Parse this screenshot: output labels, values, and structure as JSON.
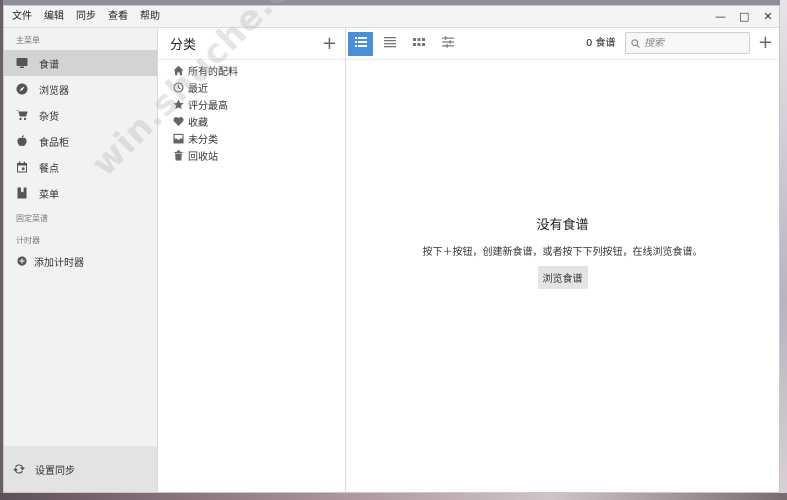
{
  "menubar": {
    "items": [
      "文件",
      "编辑",
      "同步",
      "查看",
      "帮助"
    ],
    "controls": {
      "minimize": "—",
      "maximize": "□",
      "close": "✕"
    }
  },
  "sidebar": {
    "main_label": "主菜单",
    "items": [
      {
        "label": "食谱",
        "icon": "monitor-icon",
        "active": true
      },
      {
        "label": "浏览器",
        "icon": "compass-icon",
        "active": false
      },
      {
        "label": "杂货",
        "icon": "cart-icon",
        "active": false
      },
      {
        "label": "食品柜",
        "icon": "apple-icon",
        "active": false
      },
      {
        "label": "餐点",
        "icon": "calendar-icon",
        "active": false
      },
      {
        "label": "菜单",
        "icon": "book-icon",
        "active": false
      }
    ],
    "pinned_label": "固定菜谱",
    "timer_label": "计时器",
    "add_timer": "添加计时器",
    "footer": "设置同步"
  },
  "categories": {
    "title": "分类",
    "add": "+",
    "items": [
      {
        "label": "所有的配料",
        "icon": "home-icon"
      },
      {
        "label": "最近",
        "icon": "clock-icon"
      },
      {
        "label": "评分最高",
        "icon": "star-icon"
      },
      {
        "label": "收藏",
        "icon": "heart-icon"
      },
      {
        "label": "未分类",
        "icon": "inbox-icon"
      },
      {
        "label": "回收站",
        "icon": "trash-icon"
      }
    ]
  },
  "toolbar": {
    "count": "0 食谱",
    "search_placeholder": "搜索",
    "add": "+"
  },
  "empty": {
    "title": "没有食谱",
    "description": "按下＋按钮，创建新食谱，或者按下下列按钮，在线浏览食谱。",
    "button": "浏览食谱"
  },
  "watermark": "win.shuche.cc",
  "colors": {
    "accent": "#4a90d9",
    "sidebar_bg": "#f2f2f2",
    "active_item": "#d3d3d3"
  }
}
